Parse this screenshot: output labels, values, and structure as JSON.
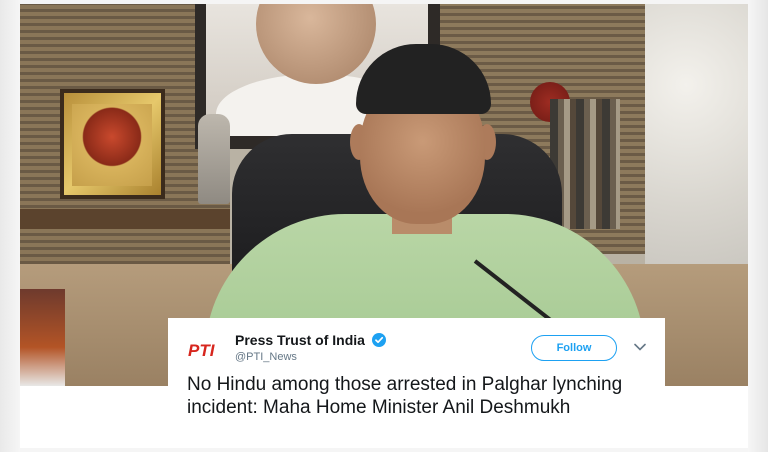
{
  "tweet": {
    "author_name": "Press Trust of India",
    "handle": "@PTI_News",
    "follow_label": "Follow",
    "text": "No Hindu among those arrested in Palghar lynching incident: Maha Home Minister Anil Deshmukh",
    "logo_text": "PTI"
  },
  "icons": {
    "verified": "verified-badge-icon",
    "more": "chevron-down-icon"
  },
  "colors": {
    "twitter_blue": "#1da1f2",
    "pti_red": "#d7261e",
    "text_primary": "#14171a",
    "text_secondary": "#657786"
  }
}
